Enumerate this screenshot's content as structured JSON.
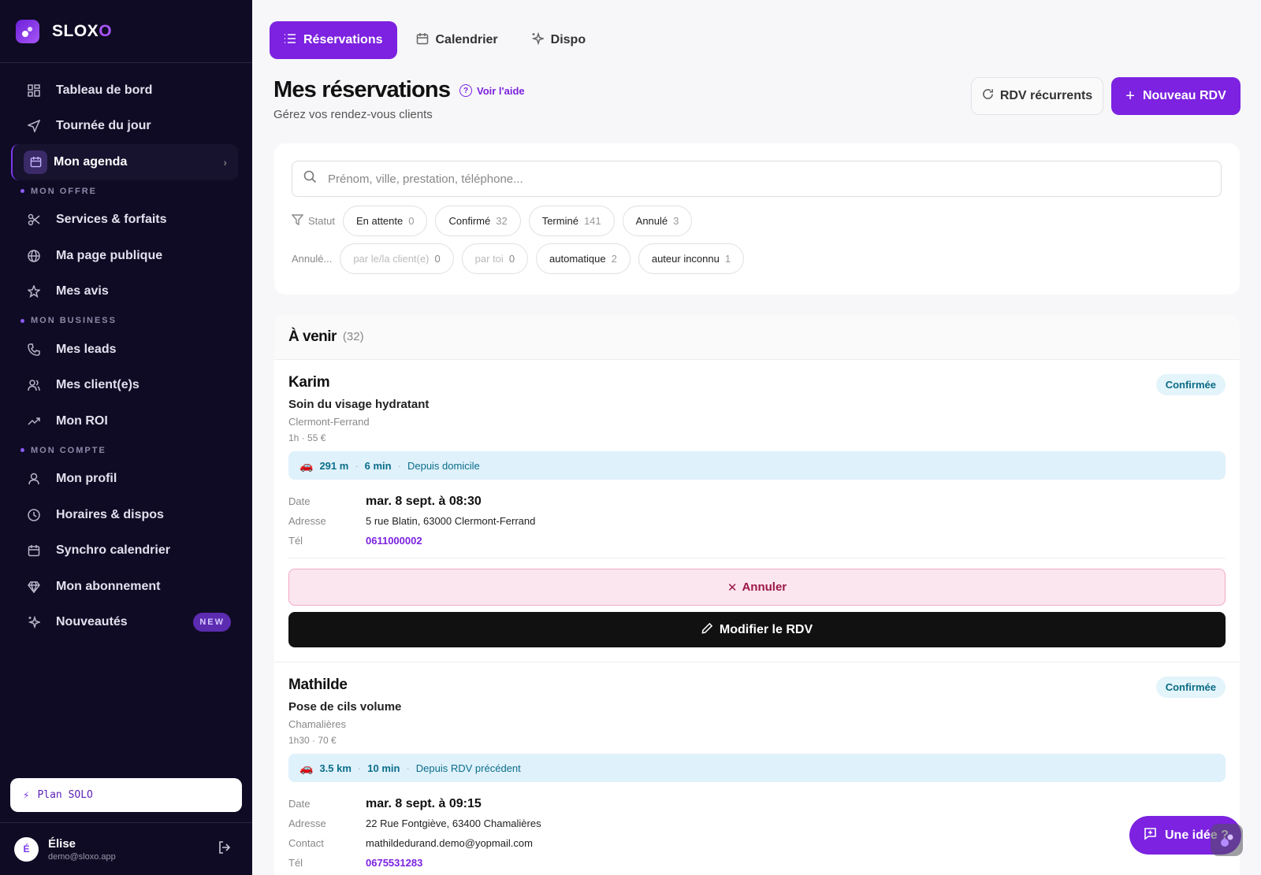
{
  "brand": {
    "name_main": "SLOX",
    "name_accent": "O"
  },
  "sidebar": {
    "items": [
      {
        "label": "Tableau de bord",
        "icon": "dashboard-icon"
      },
      {
        "label": "Tournée du jour",
        "icon": "navigation-icon"
      },
      {
        "label": "Mon agenda",
        "icon": "calendar-icon",
        "active": true
      }
    ],
    "sections": [
      {
        "title": "MON OFFRE",
        "items": [
          {
            "label": "Services & forfaits",
            "icon": "scissors-icon"
          },
          {
            "label": "Ma page publique",
            "icon": "globe-icon"
          },
          {
            "label": "Mes avis",
            "icon": "star-icon"
          }
        ]
      },
      {
        "title": "MON BUSINESS",
        "items": [
          {
            "label": "Mes leads",
            "icon": "phone-icon"
          },
          {
            "label": "Mes client(e)s",
            "icon": "users-icon"
          },
          {
            "label": "Mon ROI",
            "icon": "trending-up-icon"
          }
        ]
      },
      {
        "title": "MON COMPTE",
        "items": [
          {
            "label": "Mon profil",
            "icon": "user-icon"
          },
          {
            "label": "Horaires & dispos",
            "icon": "clock-icon"
          },
          {
            "label": "Synchro calendrier",
            "icon": "calendar-sync-icon"
          },
          {
            "label": "Mon abonnement",
            "icon": "diamond-icon"
          },
          {
            "label": "Nouveautés",
            "icon": "sparkles-icon",
            "badge": "NEW"
          }
        ]
      }
    ],
    "plan_label": "Plan SOLO",
    "user": {
      "initial": "É",
      "name": "Élise",
      "email": "demo@sloxo.app"
    }
  },
  "tabs": [
    {
      "label": "Réservations",
      "active": true
    },
    {
      "label": "Calendrier"
    },
    {
      "label": "Dispo"
    }
  ],
  "header": {
    "title": "Mes réservations",
    "help": "Voir l'aide",
    "subtitle": "Gérez vos rendez-vous clients",
    "recurring_button": "RDV récurrents",
    "new_button": "Nouveau RDV"
  },
  "filters": {
    "search_placeholder": "Prénom, ville, prestation, téléphone...",
    "status_label": "Statut",
    "status_chips": [
      {
        "label": "En attente",
        "count": "0"
      },
      {
        "label": "Confirmé",
        "count": "32"
      },
      {
        "label": "Terminé",
        "count": "141"
      },
      {
        "label": "Annulé",
        "count": "3"
      }
    ],
    "cancel_label": "Annulé...",
    "cancel_chips": [
      {
        "label": "par le/la client(e)",
        "count": "0",
        "muted": true
      },
      {
        "label": "par toi",
        "count": "0",
        "muted": true
      },
      {
        "label": "automatique",
        "count": "2"
      },
      {
        "label": "auteur inconnu",
        "count": "1"
      }
    ]
  },
  "list": {
    "title": "À venir",
    "count": "(32)",
    "labels": {
      "date": "Date",
      "address": "Adresse",
      "contact": "Contact",
      "phone": "Tél"
    },
    "cancel_button": "Annuler",
    "edit_button": "Modifier le RDV",
    "appointments": [
      {
        "name": "Karim",
        "status": "Confirmée",
        "service": "Soin du visage hydratant",
        "city": "Clermont-Ferrand",
        "duration": "1h",
        "price": "55 €",
        "distance": "291 m",
        "travel_time": "6 min",
        "origin": "Depuis domicile",
        "date": "mar. 8 sept. à 08:30",
        "address": "5 rue Blatin, 63000 Clermont-Ferrand",
        "phone": "0611000002"
      },
      {
        "name": "Mathilde",
        "status": "Confirmée",
        "service": "Pose de cils volume",
        "city": "Chamalières",
        "duration": "1h30",
        "price": "70 €",
        "distance": "3.5 km",
        "travel_time": "10 min",
        "origin": "Depuis RDV précédent",
        "date": "mar. 8 sept. à 09:15",
        "address": "22 Rue Fontgiève, 63400 Chamalières",
        "contact": "mathildedurand.demo@yopmail.com",
        "phone": "0675531283"
      }
    ]
  },
  "feedback_button": "Une idée ?"
}
